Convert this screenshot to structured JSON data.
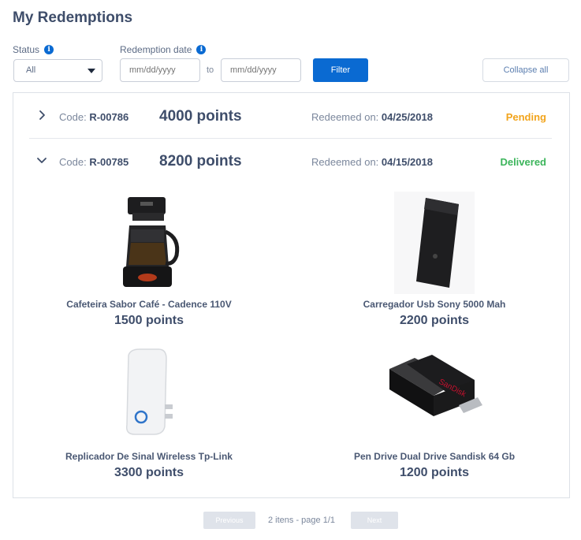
{
  "page": {
    "title": "My Redemptions"
  },
  "filters": {
    "status_label": "Status",
    "status_value": "All",
    "date_label": "Redemption date",
    "date_from_placeholder": "mm/dd/yyyy",
    "date_to_placeholder": "mm/dd/yyyy",
    "to_label": "to",
    "filter_button": "Filter",
    "collapse_button": "Collapse all",
    "info_icon": "i"
  },
  "redemptions": [
    {
      "code_label": "Code: ",
      "code": "R-00786",
      "points": "4000 points",
      "redeemed_label": "Redeemed on: ",
      "date": "04/25/2018",
      "status": "Pending",
      "status_color": "#f2a41c",
      "expanded": false
    },
    {
      "code_label": "Code: ",
      "code": "R-00785",
      "points": "8200 points",
      "redeemed_label": "Redeemed on: ",
      "date": "04/15/2018",
      "status": "Delivered",
      "status_color": "#3cb55b",
      "expanded": true,
      "items": [
        {
          "name": "Cafeteira Sabor Café - Cadence 110V",
          "points": "1500 points",
          "icon": "coffee-maker"
        },
        {
          "name": "Carregador Usb Sony 5000 Mah",
          "points": "2200 points",
          "icon": "power-bank"
        },
        {
          "name": "Replicador De Sinal Wireless Tp-Link",
          "points": "3300 points",
          "icon": "wifi-extender"
        },
        {
          "name": "Pen Drive Dual Drive Sandisk 64 Gb",
          "points": "1200 points",
          "icon": "usb-drive"
        }
      ]
    }
  ],
  "pagination": {
    "previous": "Previous",
    "info": "2 itens - page 1/1",
    "next": "Next"
  },
  "colors": {
    "accent": "#0a6ad2",
    "pending": "#f2a41c",
    "delivered": "#3cb55b"
  }
}
